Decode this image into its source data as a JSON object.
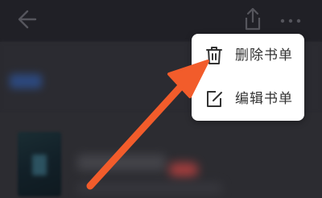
{
  "header": {
    "back_icon": "back-arrow-icon",
    "share_icon": "share-icon",
    "more_icon": "more-dots-icon"
  },
  "menu": {
    "items": [
      {
        "label": "删除书单",
        "icon": "trash-icon"
      },
      {
        "label": "编辑书单",
        "icon": "edit-icon"
      }
    ]
  },
  "annotation": {
    "arrow_color": "#f25c2b",
    "points_to": "删除书单"
  },
  "colors": {
    "background": "#2a2a30",
    "menu_bg": "#ffffff",
    "menu_text": "#333333",
    "accent_arrow": "#f25c2b"
  }
}
